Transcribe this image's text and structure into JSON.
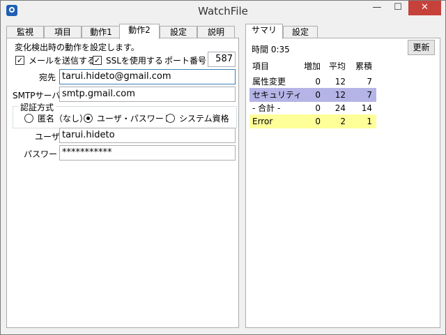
{
  "window": {
    "title": "WatchFile",
    "minimize": "—",
    "maximize": "☐",
    "close": "✕"
  },
  "left_tabs": [
    "監視",
    "項目",
    "動作1",
    "動作2",
    "設定",
    "説明"
  ],
  "left_active_tab": "動作2",
  "action2": {
    "description": "変化検出時の動作を設定します。",
    "send_mail_label": "メールを送信する",
    "send_mail_checked": true,
    "use_ssl_label": "SSLを使用する",
    "use_ssl_checked": true,
    "port_label": "ポート番号",
    "port_value": "587",
    "to_label": "宛先",
    "to_value": "tarui.hideto@gmail.com",
    "smtp_label": "SMTPサーバ",
    "smtp_value": "smtp.gmail.com",
    "auth_label": "認証方式",
    "auth_options": [
      "匿名（なし）",
      "ユーザ・パスワード",
      "システム資格"
    ],
    "auth_selected": "ユーザ・パスワード",
    "user_label": "ユーザ",
    "user_value": "tarui.hideto",
    "password_label": "パスワード",
    "password_value": "***********"
  },
  "right_tabs": [
    "サマリ",
    "設定"
  ],
  "right_active_tab": "サマリ",
  "summary": {
    "time_label": "時間 0:35",
    "refresh_label": "更新",
    "columns": [
      "項目",
      "増加",
      "平均",
      "累積"
    ],
    "rows": [
      {
        "item": "属性変更",
        "inc": "0",
        "avg": "12",
        "cum": "7",
        "highlight": "none"
      },
      {
        "item": "セキュリティ...",
        "inc": "0",
        "avg": "12",
        "cum": "7",
        "highlight": "#b4b4e6"
      },
      {
        "item": "- 合計 -",
        "inc": "0",
        "avg": "24",
        "cum": "14",
        "highlight": "none"
      },
      {
        "item": "Error",
        "inc": "0",
        "avg": "2",
        "cum": "1",
        "highlight": "#ffff99"
      }
    ]
  },
  "colors": {
    "close_button": "#c7413b",
    "focus_border": "#3c7fb1",
    "selected_row": "#b4b4e6",
    "error_row": "#ffff99"
  }
}
